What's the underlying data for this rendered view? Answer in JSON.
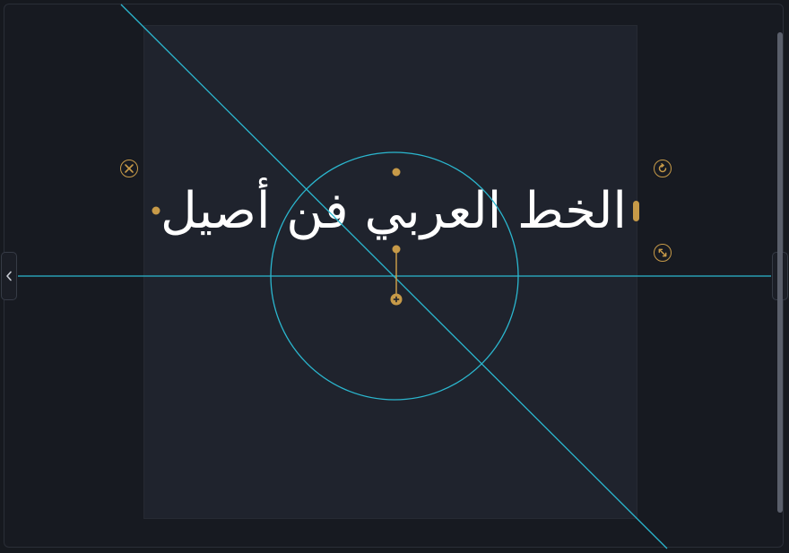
{
  "canvas": {
    "text": "الخط العربي فن أصيل"
  },
  "controls": {
    "delete_icon": "close-circle-icon",
    "rotate_icon": "rotate-icon",
    "resize_icon": "resize-diagonal-icon",
    "anchor_icon": "plus-anchor-icon"
  },
  "nav": {
    "left_toggle_icon": "chevron-left-icon",
    "right_toggle_icon": "chevron-right-icon"
  },
  "colors": {
    "guide": "#2bb7cf",
    "handle": "#c79a48",
    "text": "#ffffff",
    "page": "#1f232d",
    "workspace": "#171a21"
  }
}
